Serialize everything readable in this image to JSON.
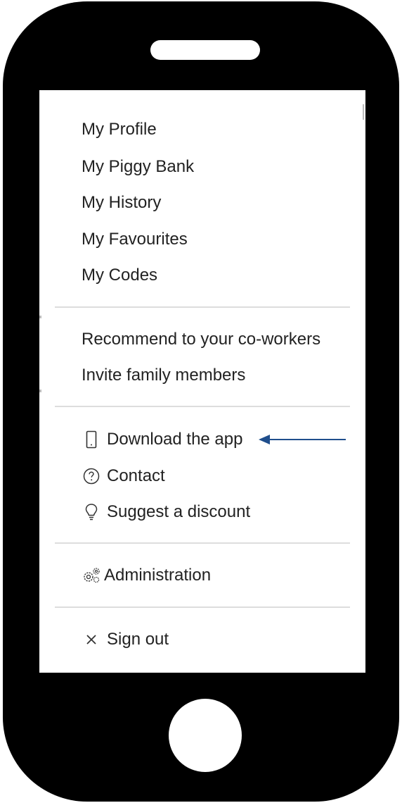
{
  "menu": {
    "account": [
      {
        "label": "My Profile"
      },
      {
        "label": "My Piggy Bank"
      },
      {
        "label": "My History"
      },
      {
        "label": "My Favourites"
      },
      {
        "label": "My Codes"
      }
    ],
    "share": [
      {
        "label": "Recommend to your co-workers"
      },
      {
        "label": "Invite family members"
      }
    ],
    "support": [
      {
        "label": "Download the app",
        "icon": "phone-icon"
      },
      {
        "label": "Contact",
        "icon": "question-circle-icon"
      },
      {
        "label": "Suggest a discount",
        "icon": "lightbulb-icon"
      }
    ],
    "admin": [
      {
        "label": "Administration",
        "icon": "gears-icon"
      }
    ],
    "session": [
      {
        "label": "Sign out",
        "icon": "close-icon"
      }
    ]
  },
  "colors": {
    "phone_frame": "#000000",
    "text": "#222222",
    "divider": "#dddddd",
    "annotation_arrow": "#1f4e8c"
  }
}
